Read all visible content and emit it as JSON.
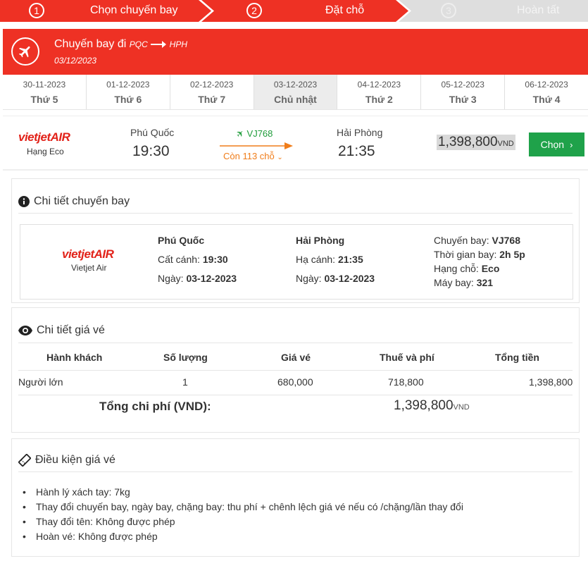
{
  "steps": [
    {
      "num": "1",
      "label": "Chọn chuyến bay"
    },
    {
      "num": "2",
      "label": "Đặt chỗ"
    },
    {
      "num": "3",
      "label": "Hoàn tất"
    }
  ],
  "flight_header": {
    "title": "Chuyến bay đi",
    "from_code": "PQC",
    "to_code": "HPH",
    "date": "03/12/2023"
  },
  "date_tabs": [
    {
      "date": "30-11-2023",
      "weekday": "Thứ 5"
    },
    {
      "date": "01-12-2023",
      "weekday": "Thứ 6"
    },
    {
      "date": "02-12-2023",
      "weekday": "Thứ 7"
    },
    {
      "date": "03-12-2023",
      "weekday": "Chủ nhật"
    },
    {
      "date": "04-12-2023",
      "weekday": "Thứ 2"
    },
    {
      "date": "05-12-2023",
      "weekday": "Thứ 3"
    },
    {
      "date": "06-12-2023",
      "weekday": "Thứ 4"
    }
  ],
  "flight": {
    "airline_logo": "vietjetAIR",
    "class": "Hạng Eco",
    "from_city": "Phú Quốc",
    "depart_time": "19:30",
    "flight_code": "VJ768",
    "seats_left": "Còn 113 chỗ",
    "to_city": "Hải Phòng",
    "arrive_time": "21:35",
    "price": "1,398,800",
    "currency": "VND",
    "choose_label": "Chọn"
  },
  "flight_detail": {
    "title": "Chi tiết chuyến bay",
    "airline_logo": "vietjetAIR",
    "airline_name": "Vietjet Air",
    "from_city": "Phú Quốc",
    "depart_label": "Cất cánh:",
    "depart_time": "19:30",
    "from_date_label": "Ngày:",
    "from_date": "03-12-2023",
    "to_city": "Hải Phòng",
    "arrive_label": "Hạ cánh:",
    "arrive_time": "21:35",
    "to_date_label": "Ngày:",
    "to_date": "03-12-2023",
    "flight_label": "Chuyến bay:",
    "flight_code": "VJ768",
    "duration_label": "Thời gian bay:",
    "duration": "2h 5p",
    "class_label": "Hạng chỗ:",
    "class": "Eco",
    "aircraft_label": "Máy bay:",
    "aircraft": "321"
  },
  "price_detail": {
    "title": "Chi tiết giá vé",
    "headers": [
      "Hành khách",
      "Số lượng",
      "Giá vé",
      "Thuế và phí",
      "Tổng tiền"
    ],
    "row": [
      "Người lớn",
      "1",
      "680,000",
      "718,800",
      "1,398,800"
    ],
    "total_label": "Tổng chi phí (VND):",
    "total_value": "1,398,800",
    "total_currency": "VND"
  },
  "conditions": {
    "title": "Điều kiện giá vé",
    "items": [
      "Hành lý xách tay: 7kg",
      "Thay đổi chuyến bay, ngày bay, chặng bay: thu phí + chênh lệch giá vé nếu có /chặng/lần thay đổi",
      "Thay đổi tên: Không được phép",
      "Hoàn vé: Không được phép"
    ]
  },
  "colors": {
    "brand_red": "#ee3124",
    "inactive_step": "#dedede",
    "choose_green": "#1fa24a",
    "flight_code_green": "#1e9c3a",
    "seats_orange": "#f07d1a"
  }
}
